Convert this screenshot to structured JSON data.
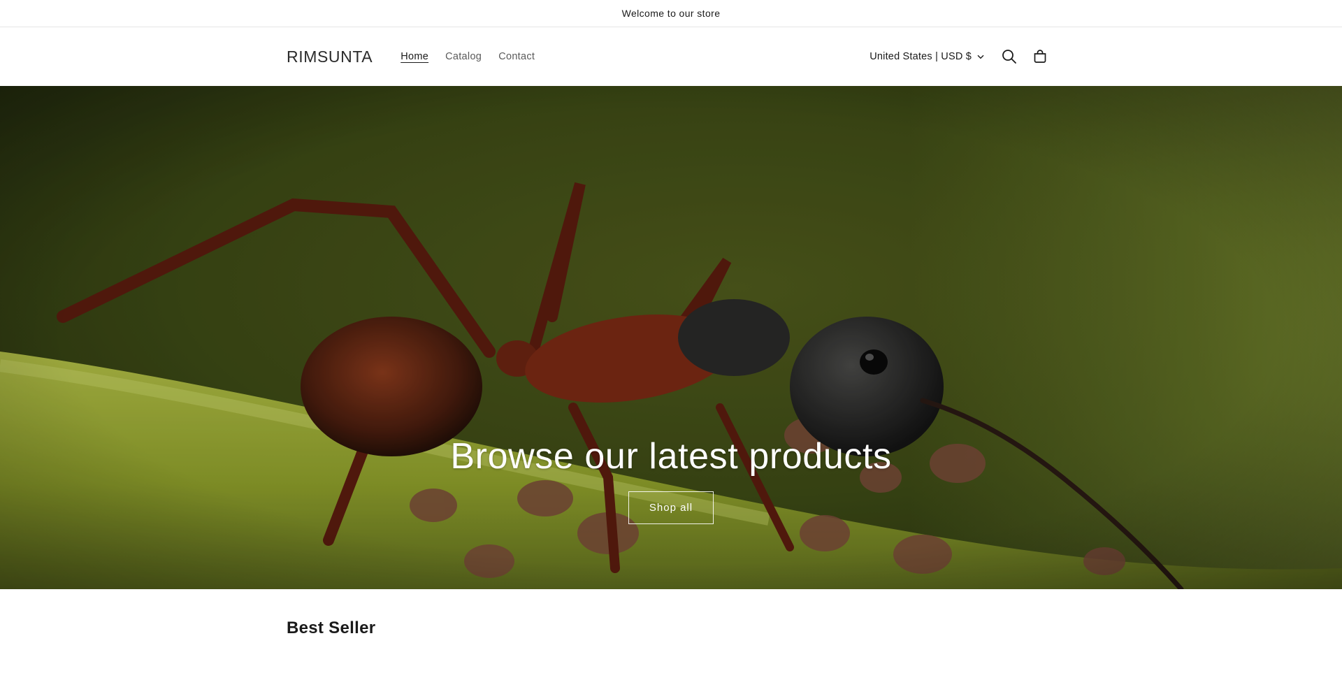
{
  "announcement": {
    "text": "Welcome to our store"
  },
  "header": {
    "logo": "RIMSUNTA",
    "nav": [
      {
        "label": "Home",
        "active": true
      },
      {
        "label": "Catalog",
        "active": false
      },
      {
        "label": "Contact",
        "active": false
      }
    ],
    "localization": "United States | USD $",
    "icons": [
      "chevron-down-icon",
      "search-icon",
      "cart-icon"
    ]
  },
  "hero": {
    "title": "Browse our latest products",
    "button_label": "Shop all",
    "image": "ant-on-plant-stem-photo"
  },
  "section": {
    "title": "Best Seller"
  },
  "colors": {
    "text": "#121212",
    "border": "#e6e6e6",
    "hero_overlay_text": "#ffffff"
  }
}
